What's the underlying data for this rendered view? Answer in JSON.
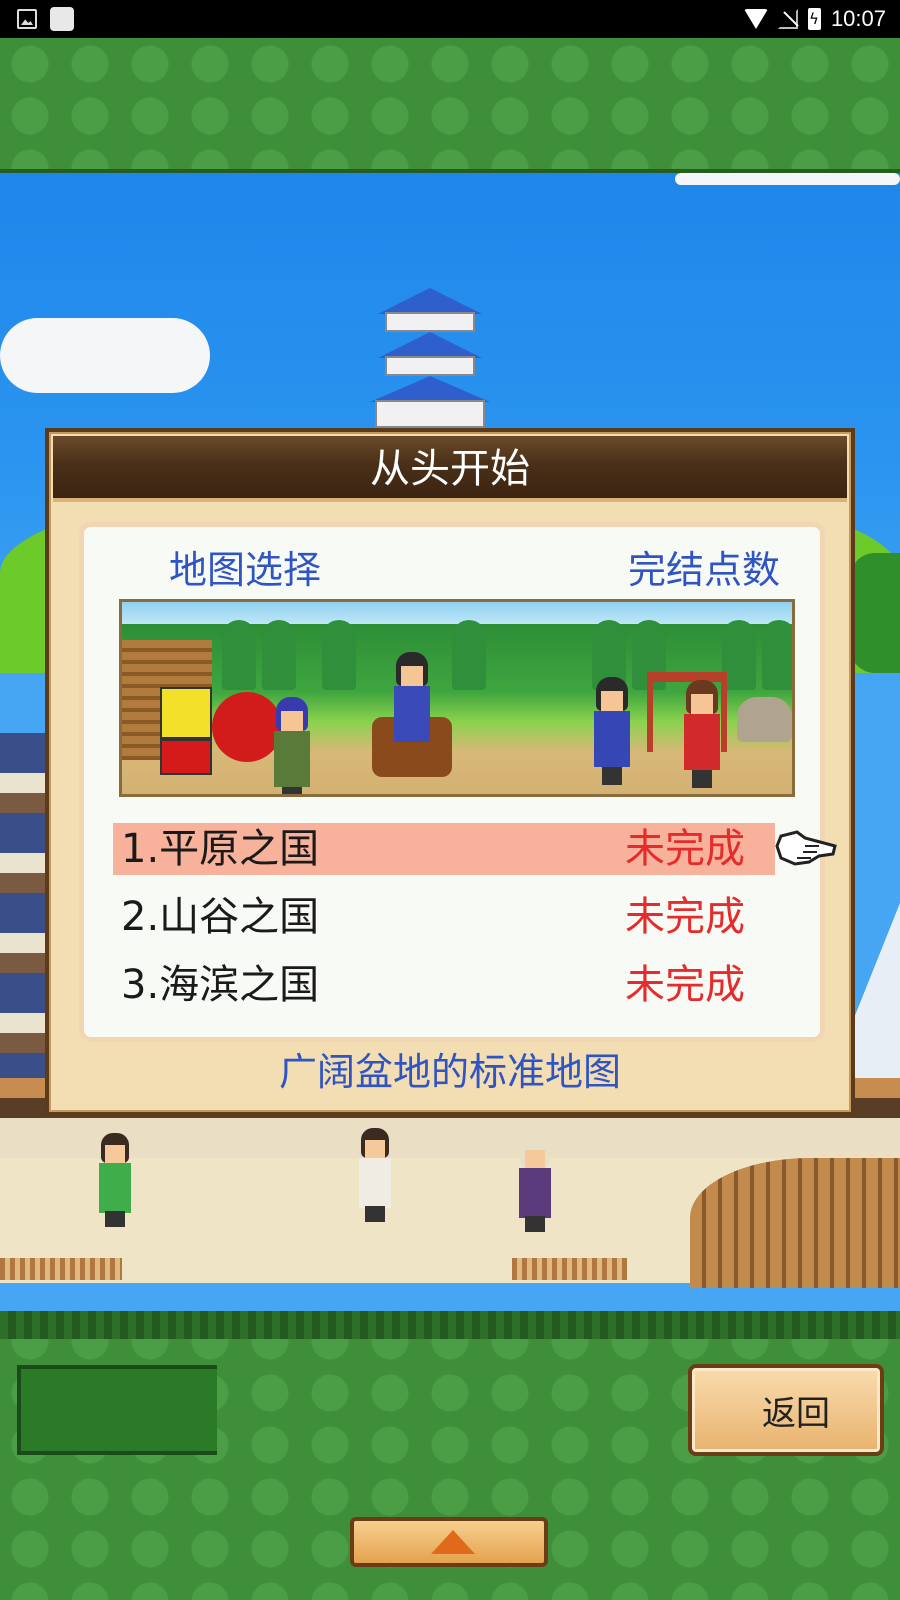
{
  "status_bar": {
    "time": "10:07",
    "icons": [
      "gallery-icon",
      "app-icon",
      "wifi-icon",
      "signal-off-icon",
      "battery-charging-icon"
    ]
  },
  "dialog": {
    "title": "从头开始",
    "header_left": "地图选择",
    "header_right": "完结点数",
    "maps": [
      {
        "name": "1.平原之国",
        "status": "未完成",
        "selected": true
      },
      {
        "name": "2.山谷之国",
        "status": "未完成",
        "selected": false
      },
      {
        "name": "3.海滨之国",
        "status": "未完成",
        "selected": false
      }
    ],
    "description": "广阔盆地的标准地图"
  },
  "bottom_bar": {
    "back_label": "返回",
    "up_icon": "up-arrow-icon"
  },
  "colors": {
    "green": "#3f8f3a",
    "title_blue": "#2f55c4",
    "status_red": "#e52b2b",
    "selected_row": "#f8b19a",
    "dialog_bg": "#f3ddb2"
  }
}
